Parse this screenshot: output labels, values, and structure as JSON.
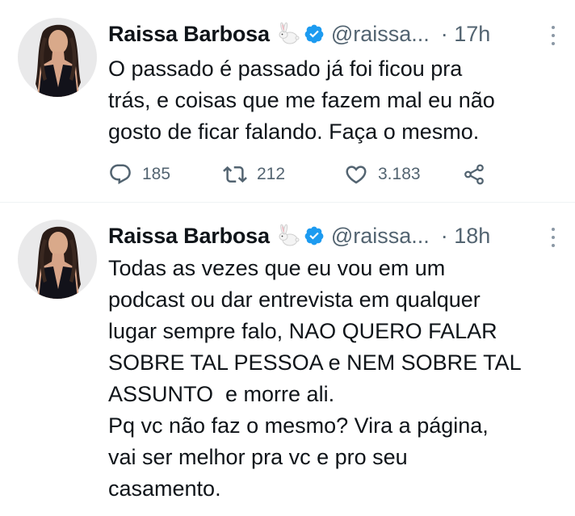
{
  "colors": {
    "text": "#0f1419",
    "secondary": "#536471",
    "verified": "#1d9bf0",
    "divider": "#eff3f4"
  },
  "tweets": [
    {
      "display_name": "Raissa Barbosa",
      "name_emoji": "rabbit-emoji",
      "handle": "@raissa...",
      "time": "· 17h",
      "lines": [
        "O passado é passado já foi ficou pra",
        "trás, e coisas que me fazem mal eu não",
        "gosto de ficar falando. Faça o mesmo."
      ],
      "actions": {
        "replies": "185",
        "retweets": "212",
        "likes": "3.183"
      }
    },
    {
      "display_name": "Raissa Barbosa",
      "name_emoji": "rabbit-emoji",
      "handle": "@raissa...",
      "time": "· 18h",
      "lines": [
        "Todas as vezes que eu vou em um",
        "podcast ou dar entrevista em qualquer",
        "lugar sempre falo, NAO QUERO FALAR",
        "SOBRE TAL PESSOA e NEM SOBRE TAL",
        "ASSUNTO  e morre ali.",
        "Pq vc não faz o mesmo? Vira a página,",
        "vai ser melhor pra vc e pro seu",
        "casamento."
      ]
    }
  ]
}
